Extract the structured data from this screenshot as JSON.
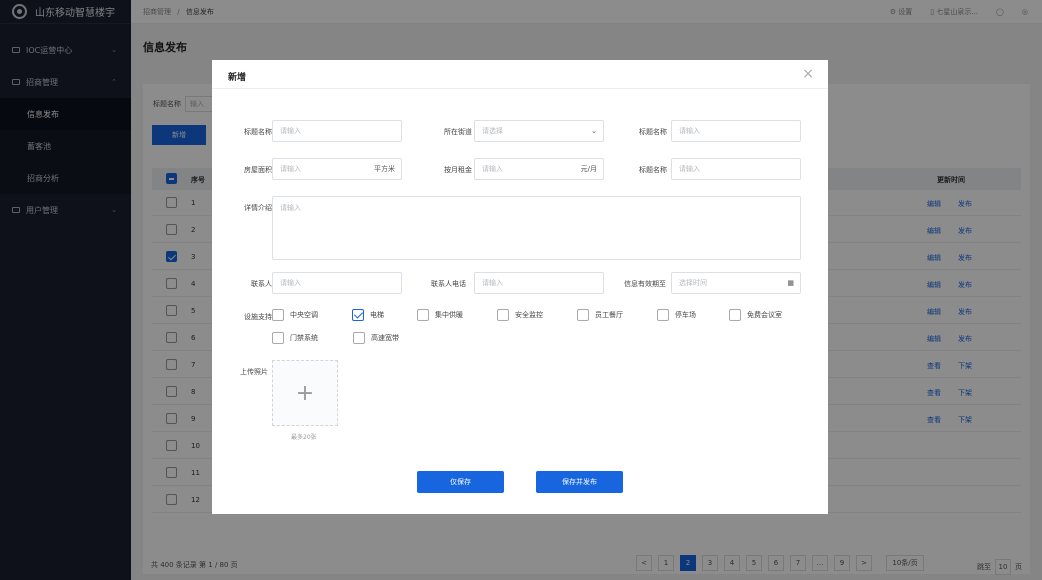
{
  "app": {
    "title": "山东移动智慧楼宇"
  },
  "sidebar": {
    "items": [
      {
        "label": "IOC运营中心"
      },
      {
        "label": "招商管理"
      },
      {
        "label": "信息发布"
      },
      {
        "label": "蓄客池"
      },
      {
        "label": "招商分析"
      },
      {
        "label": "用户管理"
      }
    ]
  },
  "topbar": {
    "breadcrumb_parent": "招商管理",
    "breadcrumb_sep": "/",
    "breadcrumb_current": "信息发布",
    "settings": "设置",
    "org": "七星山泉示...",
    "bell": "◯",
    "user": "◎"
  },
  "page": {
    "title": "信息发布",
    "filter_label": "标题名称",
    "filter_placeholder": "输入",
    "add_button": "新增",
    "col_index": "序号",
    "col_update": "更新时间",
    "rows": [
      {
        "n": "1",
        "seg": "5",
        "a": "编辑",
        "b": "发布",
        "checked": false
      },
      {
        "n": "2",
        "seg": "5",
        "a": "编辑",
        "b": "发布",
        "checked": false
      },
      {
        "n": "3",
        "seg": "5",
        "a": "编辑",
        "b": "发布",
        "checked": true
      },
      {
        "n": "4",
        "seg": "5",
        "a": "编辑",
        "b": "发布",
        "checked": false
      },
      {
        "n": "5",
        "seg": "5",
        "a": "编辑",
        "b": "发布",
        "checked": false
      },
      {
        "n": "6",
        "seg": "5",
        "a": "编辑",
        "b": "发布",
        "checked": false
      },
      {
        "n": "7",
        "seg": "5",
        "a": "查看",
        "b": "下架",
        "checked": false
      },
      {
        "n": "8",
        "seg": "5",
        "a": "查看",
        "b": "下架",
        "checked": false
      },
      {
        "n": "9",
        "seg": "5",
        "a": "查看",
        "b": "下架",
        "checked": false
      },
      {
        "n": "10",
        "seg": "5",
        "a": "",
        "b": "",
        "checked": false
      },
      {
        "n": "11",
        "seg": "5",
        "a": "",
        "b": "",
        "checked": false
      },
      {
        "n": "12",
        "seg": "5",
        "a": "",
        "b": "",
        "checked": false
      }
    ],
    "total": "共 400 条记录  第 1 / 80 页",
    "pages": [
      "<",
      "1",
      "2",
      "3",
      "4",
      "5",
      "6",
      "7",
      "...",
      "9",
      ">"
    ],
    "current_page": "2",
    "page_size": "10条/页",
    "jump_prefix": "跳至",
    "jump_value": "10",
    "jump_suffix": "页"
  },
  "modal": {
    "title": "新增",
    "close": "×",
    "fields": {
      "title1": {
        "label": "标题名称",
        "placeholder": "请输入"
      },
      "street": {
        "label": "所在街道",
        "placeholder": "请选择"
      },
      "title2": {
        "label": "标题名称",
        "placeholder": "请输入"
      },
      "area": {
        "label": "房屋面积",
        "placeholder": "请输入",
        "unit": "平方米"
      },
      "rent": {
        "label": "按月租金",
        "placeholder": "请输入",
        "unit": "元/月"
      },
      "title3": {
        "label": "标题名称",
        "placeholder": "请输入"
      },
      "detail": {
        "label": "详情介绍",
        "placeholder": "请输入"
      },
      "contact": {
        "label": "联系人",
        "placeholder": "请输入"
      },
      "phone": {
        "label": "联系人电话",
        "placeholder": "请输入"
      },
      "expire": {
        "label": "信息有效期至",
        "placeholder": "选择时间"
      }
    },
    "facility_label": "设施支持",
    "facilities": [
      {
        "label": "中央空调",
        "checked": false
      },
      {
        "label": "电梯",
        "checked": true
      },
      {
        "label": "集中供暖",
        "checked": false
      },
      {
        "label": "安全监控",
        "checked": false
      },
      {
        "label": "员工餐厅",
        "checked": false
      },
      {
        "label": "停车场",
        "checked": false
      },
      {
        "label": "免费会议室",
        "checked": false
      },
      {
        "label": "门禁系统",
        "checked": false
      },
      {
        "label": "高速宽带",
        "checked": false
      }
    ],
    "upload_label": "上传照片",
    "upload_hint": "最多20张",
    "save_button": "仅保存",
    "publish_button": "保存并发布"
  },
  "colors": {
    "primary": "#1766e0",
    "sidebar_bg": "#1b1f30"
  }
}
